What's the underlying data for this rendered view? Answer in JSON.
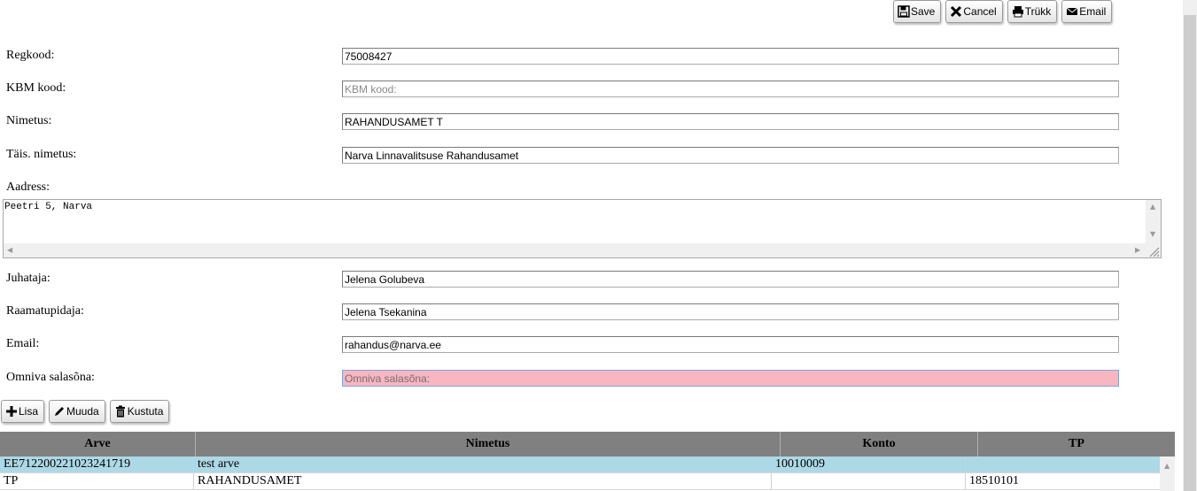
{
  "toolbar": {
    "save_label": "Save",
    "cancel_label": "Cancel",
    "print_label": "Trükk",
    "email_label": "Email"
  },
  "form": {
    "regkood": {
      "label": "Regkood:",
      "value": "75008427",
      "placeholder": "Regkood:"
    },
    "kbm": {
      "label": "KBM kood:",
      "value": "",
      "placeholder": "KBM kood:"
    },
    "nimetus": {
      "label": "Nimetus:",
      "value": "RAHANDUSAMET T",
      "placeholder": "Nimetus:"
    },
    "tais_nimetus": {
      "label": "Täis. nimetus:",
      "value": "Narva Linnavalitsuse Rahandusamet",
      "placeholder": "Täis. nimetus:"
    },
    "aadress": {
      "label": "Aadress:",
      "value": "Peetri 5, Narva"
    },
    "juhataja": {
      "label": "Juhataja:",
      "value": "Jelena Golubeva",
      "placeholder": "Juhataja:"
    },
    "raamatupidaja": {
      "label": "Raamatupidaja:",
      "value": "Jelena Tsekanina",
      "placeholder": "Raamatupidaja:"
    },
    "email": {
      "label": "Email:",
      "value": "rahandus@narva.ee",
      "placeholder": "Email:"
    },
    "omniva": {
      "label": "Omniva salasõna:",
      "value": "",
      "placeholder": "Omniva salasõna:"
    }
  },
  "actions": {
    "add_label": "Lisa",
    "edit_label": "Muuda",
    "delete_label": "Kustuta"
  },
  "grid": {
    "columns": [
      "Arve",
      "Nimetus",
      "Konto",
      "TP"
    ],
    "rows": [
      {
        "arve": "EE712200221023241719",
        "nimetus": "test arve",
        "konto": "10010009",
        "tp": ""
      },
      {
        "arve": "TP",
        "nimetus": "RAHANDUSAMET",
        "konto": "",
        "tp": "18510101"
      }
    ]
  },
  "colors": {
    "header_bg": "#808080",
    "selected_row": "#add8e6",
    "required_field": "#f7b6c0"
  }
}
